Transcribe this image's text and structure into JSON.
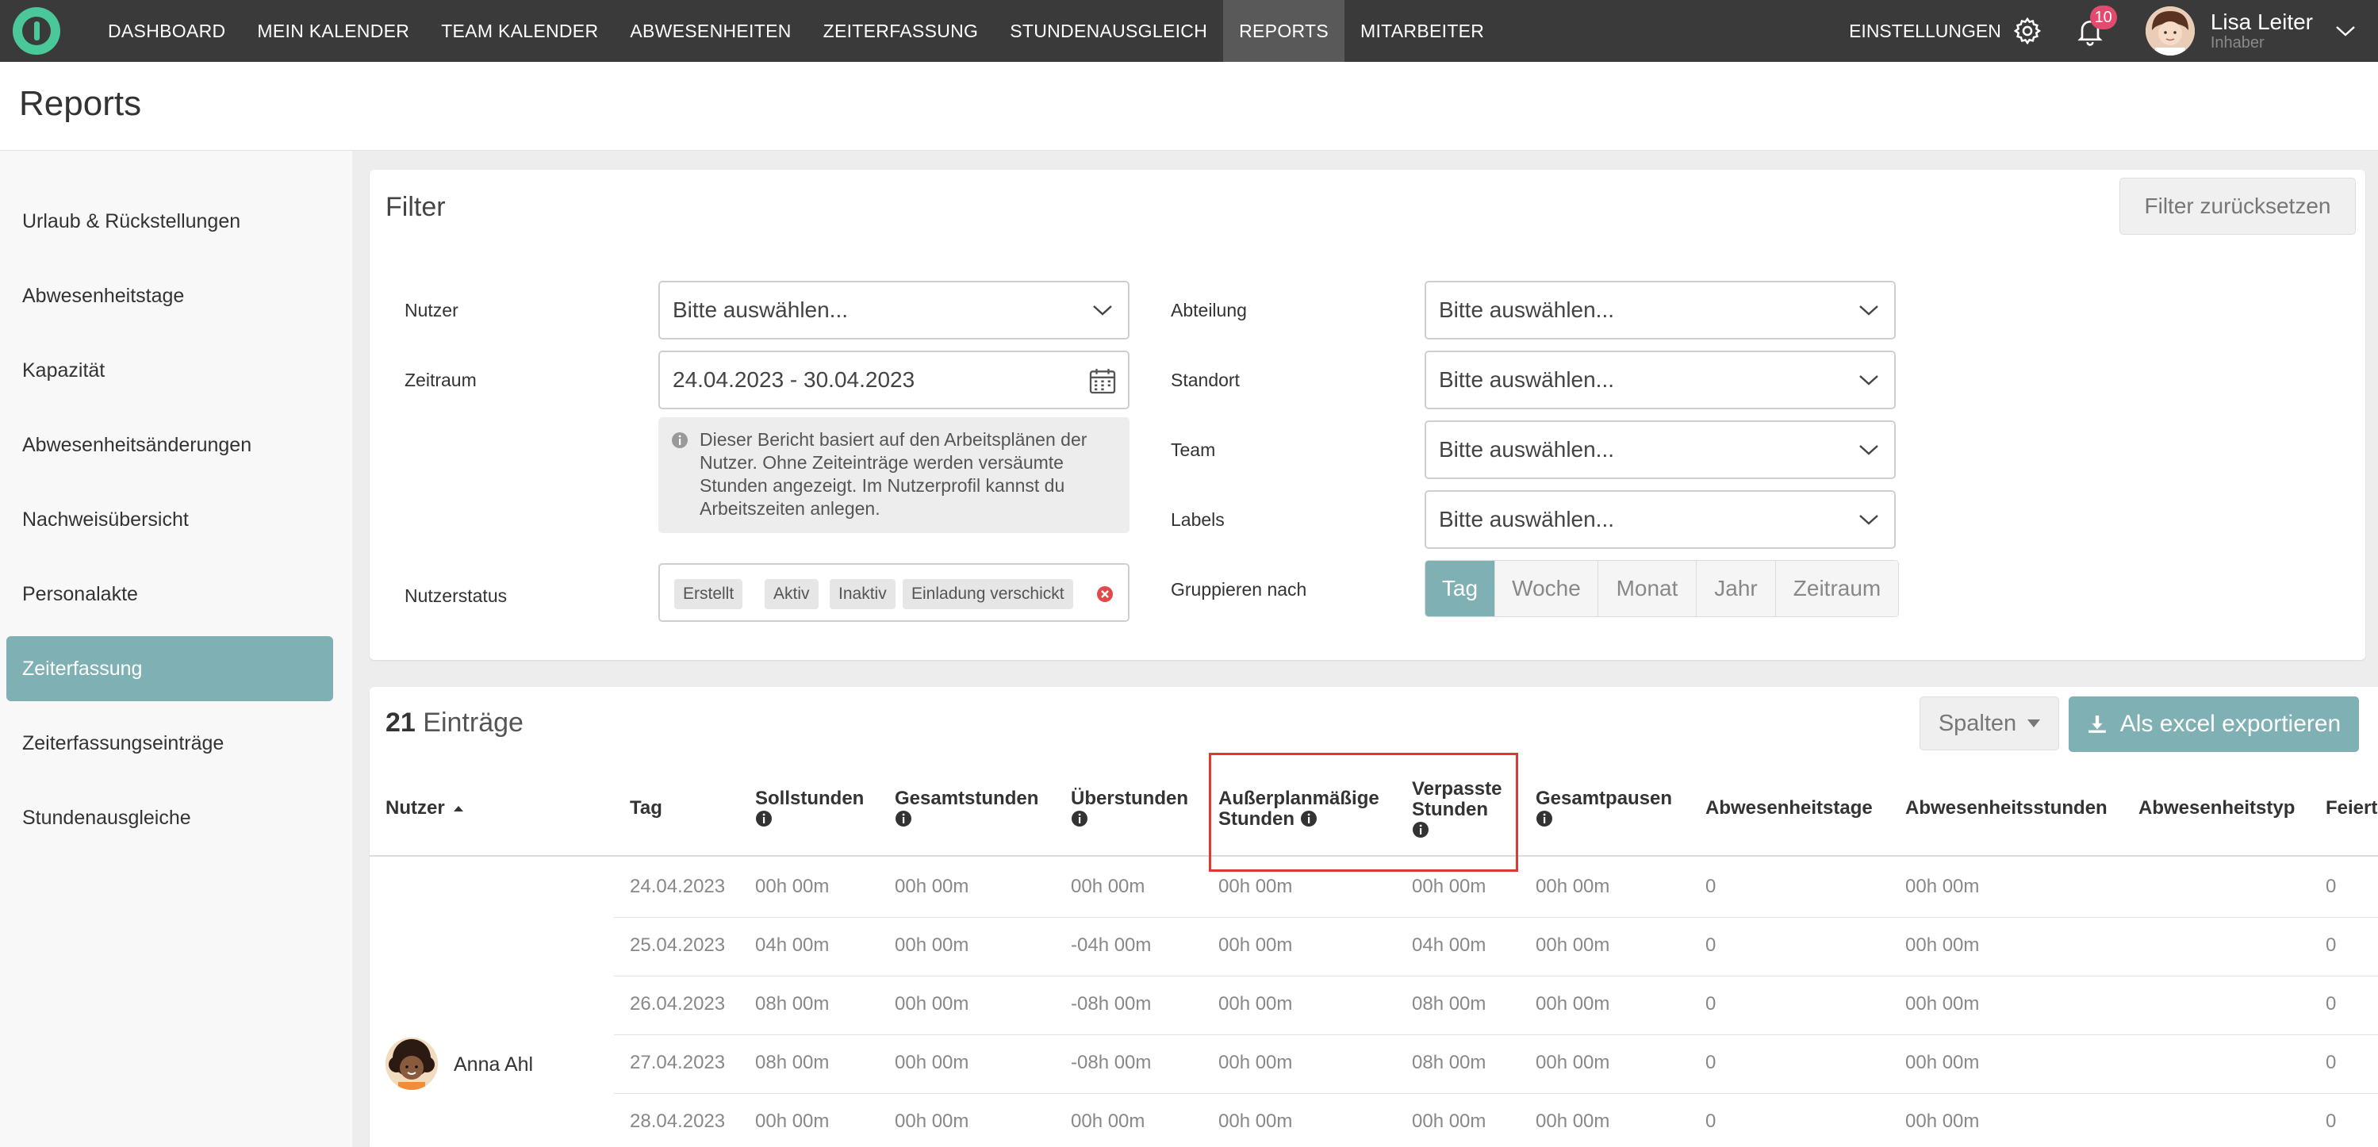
{
  "nav": {
    "items": [
      {
        "label": "DASHBOARD"
      },
      {
        "label": "MEIN KALENDER"
      },
      {
        "label": "TEAM KALENDER"
      },
      {
        "label": "ABWESENHEITEN"
      },
      {
        "label": "ZEITERFASSUNG"
      },
      {
        "label": "STUNDENAUSGLEICH"
      },
      {
        "label": "REPORTS"
      },
      {
        "label": "MITARBEITER"
      }
    ],
    "settings_label": "EINSTELLUNGEN",
    "notification_count": "10",
    "user_name": "Lisa Leiter",
    "user_role": "Inhaber"
  },
  "page": {
    "title": "Reports"
  },
  "sidebar": {
    "items": [
      {
        "label": "Urlaub & Rückstellungen"
      },
      {
        "label": "Abwesenheitstage"
      },
      {
        "label": "Kapazität"
      },
      {
        "label": "Abwesenheitsänderungen"
      },
      {
        "label": "Nachweisübersicht"
      },
      {
        "label": "Personalakte"
      },
      {
        "label": "Zeiterfassung"
      },
      {
        "label": "Zeiterfassungseinträge"
      },
      {
        "label": "Stundenausgleiche"
      }
    ],
    "active_index": 6
  },
  "filter": {
    "title": "Filter",
    "reset_label": "Filter zurücksetzen",
    "user_label": "Nutzer",
    "user_placeholder": "Bitte auswählen...",
    "period_label": "Zeitraum",
    "period_value": "24.04.2023 - 30.04.2023",
    "info_text": "Dieser Bericht basiert auf den Arbeitsplänen der Nutzer. Ohne Zeiteinträge werden versäumte Stunden angezeigt. Im Nutzerprofil kannst du Arbeitszeiten anlegen.",
    "status_label": "Nutzerstatus",
    "status_tags": [
      "Erstellt",
      "Aktiv",
      "Inaktiv",
      "Einladung verschickt"
    ],
    "department_label": "Abteilung",
    "department_placeholder": "Bitte auswählen...",
    "location_label": "Standort",
    "location_placeholder": "Bitte auswählen...",
    "team_label": "Team",
    "team_placeholder": "Bitte auswählen...",
    "labels_label": "Labels",
    "labels_placeholder": "Bitte auswählen...",
    "group_label": "Gruppieren nach",
    "group_options": [
      "Tag",
      "Woche",
      "Monat",
      "Jahr",
      "Zeitraum"
    ],
    "group_selected": "Tag"
  },
  "table": {
    "count": "21",
    "count_suffix": "Einträge",
    "columns_button": "Spalten",
    "export_button": "Als excel exportieren",
    "headers": {
      "user": "Nutzer",
      "day": "Tag",
      "target": "Sollstunden",
      "total": "Gesamtstunden",
      "overtime": "Überstunden",
      "unscheduled_1": "Außerplanmäßige",
      "unscheduled_2": "Stunden",
      "missed_1": "Verpasste",
      "missed_2": "Stunden",
      "breaks": "Gesamtpausen",
      "absence_days": "Abwesenheitstage",
      "absence_hours": "Abwesenheitsstunden",
      "absence_type": "Abwesenheitstyp",
      "holiday": "Feiert"
    },
    "user_name": "Anna Ahl",
    "rows": [
      {
        "day": "24.04.2023",
        "target": "00h 00m",
        "total": "00h 00m",
        "overtime": "00h 00m",
        "unscheduled": "00h 00m",
        "missed": "00h 00m",
        "breaks": "00h 00m",
        "absence_days": "0",
        "absence_hours": "00h 00m",
        "absence_type": "",
        "holiday": "0"
      },
      {
        "day": "25.04.2023",
        "target": "04h 00m",
        "total": "00h 00m",
        "overtime": "-04h 00m",
        "unscheduled": "00h 00m",
        "missed": "04h 00m",
        "breaks": "00h 00m",
        "absence_days": "0",
        "absence_hours": "00h 00m",
        "absence_type": "",
        "holiday": "0"
      },
      {
        "day": "26.04.2023",
        "target": "08h 00m",
        "total": "00h 00m",
        "overtime": "-08h 00m",
        "unscheduled": "00h 00m",
        "missed": "08h 00m",
        "breaks": "00h 00m",
        "absence_days": "0",
        "absence_hours": "00h 00m",
        "absence_type": "",
        "holiday": "0"
      },
      {
        "day": "27.04.2023",
        "target": "08h 00m",
        "total": "00h 00m",
        "overtime": "-08h 00m",
        "unscheduled": "00h 00m",
        "missed": "08h 00m",
        "breaks": "00h 00m",
        "absence_days": "0",
        "absence_hours": "00h 00m",
        "absence_type": "",
        "holiday": "0"
      },
      {
        "day": "28.04.2023",
        "target": "00h 00m",
        "total": "00h 00m",
        "overtime": "00h 00m",
        "unscheduled": "00h 00m",
        "missed": "00h 00m",
        "breaks": "00h 00m",
        "absence_days": "0",
        "absence_hours": "00h 00m",
        "absence_type": "",
        "holiday": "0"
      }
    ]
  },
  "colors": {
    "accent": "#7fb0b3",
    "nav_bg": "#3a3a3a",
    "logo": "#4bc89a",
    "badge": "#e24b6d",
    "highlight": "#dc3a2f"
  },
  "icons": [
    "logo-icon",
    "gear-icon",
    "bell-icon",
    "chevron-down-icon",
    "calendar-icon",
    "info-icon",
    "clear-icon",
    "sort-asc-icon",
    "download-icon",
    "caret-down-icon"
  ]
}
